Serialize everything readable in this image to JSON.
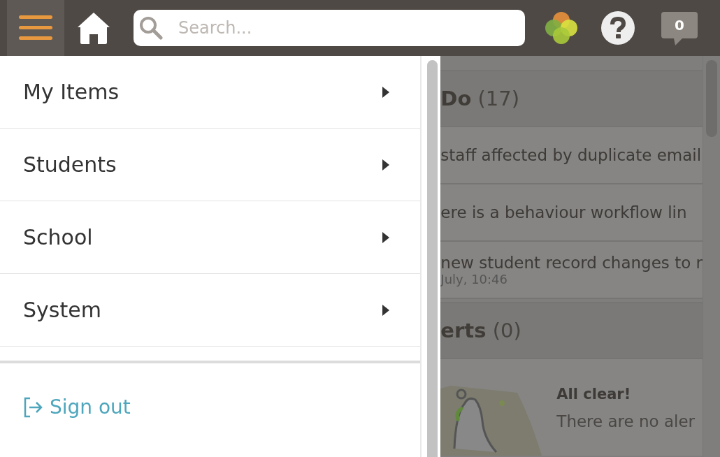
{
  "header": {
    "search": {
      "placeholder": "Search..."
    },
    "notifications": "0"
  },
  "menu": {
    "items": [
      {
        "label": "My Items"
      },
      {
        "label": "Students"
      },
      {
        "label": "School"
      },
      {
        "label": "System"
      }
    ],
    "sign_out": "Sign out"
  },
  "background": {
    "todo": {
      "title": "**Do** (17)",
      "items": [
        {
          "text": "staff affected by duplicate email"
        },
        {
          "text": "ere is a behaviour workflow lin"
        },
        {
          "text": "new student record changes to r",
          "date": "July, 10:46"
        }
      ]
    },
    "alerts": {
      "title": "**erts** (0)",
      "heading": "All clear!",
      "message": "There are no aler"
    }
  }
}
